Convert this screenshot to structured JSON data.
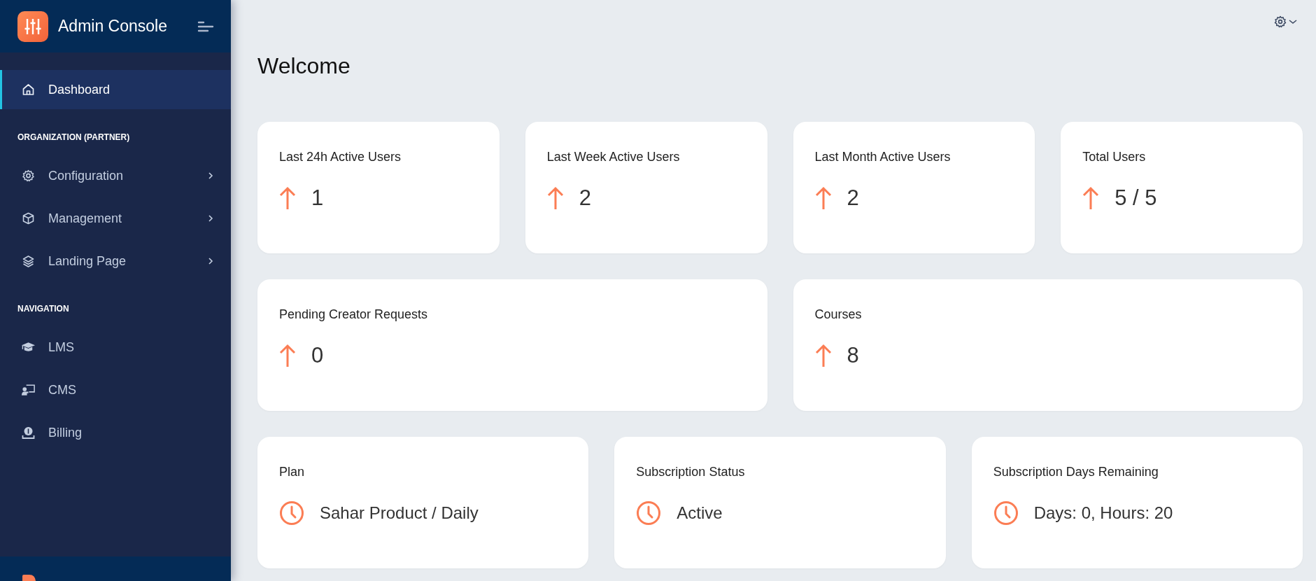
{
  "sidebar": {
    "brand": "Admin Console",
    "top_items": [
      {
        "label": "Dashboard",
        "selected": true
      }
    ],
    "sections": [
      {
        "title": "ORGANIZATION (PARTNER)",
        "items": [
          {
            "label": "Configuration",
            "selected": false,
            "expandable": true
          },
          {
            "label": "Management",
            "selected": false,
            "expandable": true
          },
          {
            "label": "Landing Page",
            "selected": false,
            "expandable": true
          }
        ]
      },
      {
        "title": "NAVIGATION",
        "items": [
          {
            "label": "LMS",
            "selected": false,
            "expandable": false
          },
          {
            "label": "CMS",
            "selected": false,
            "expandable": false
          },
          {
            "label": "Billing",
            "selected": false,
            "expandable": false
          }
        ]
      }
    ]
  },
  "page_title": "Welcome",
  "card_rows": [
    [
      {
        "kind": "trend",
        "title": "Last 24h Active Users",
        "value": "1"
      },
      {
        "kind": "trend",
        "title": "Last Week Active Users",
        "value": "2"
      },
      {
        "kind": "trend",
        "title": "Last Month Active Users",
        "value": "2"
      },
      {
        "kind": "trend",
        "title": "Total Users",
        "value": "5 / 5"
      }
    ],
    [
      {
        "kind": "trend",
        "title": "Pending Creator Requests",
        "value": "0"
      },
      {
        "kind": "trend",
        "title": "Courses",
        "value": "8"
      }
    ],
    [
      {
        "kind": "time",
        "title": "Plan",
        "value": "Sahar Product / Daily"
      },
      {
        "kind": "time",
        "title": "Subscription Status",
        "value": "Active"
      },
      {
        "kind": "time",
        "title": "Subscription Days Remaining",
        "value": "Days: 0, Hours: 20"
      }
    ]
  ]
}
